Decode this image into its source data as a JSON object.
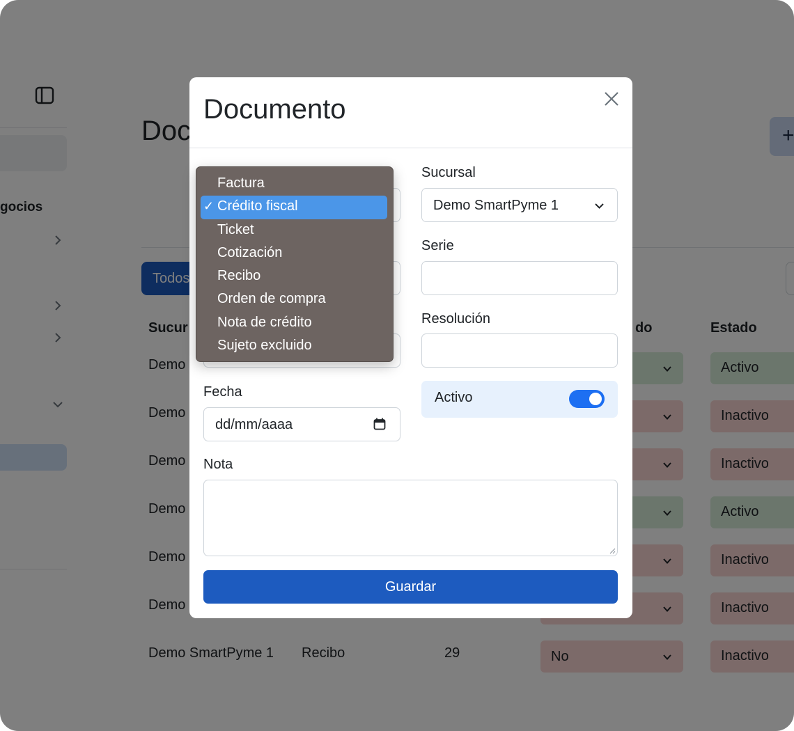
{
  "background": {
    "sidebar": {
      "section_label": "gocios"
    },
    "page_title": "Doc",
    "add_button_label": "+",
    "filter_button_label": "Todos",
    "table": {
      "headers": [
        "Sucur",
        "do",
        "Estado"
      ],
      "rows": [
        {
          "sucursal": "Demo",
          "tipo": "",
          "numero": "",
          "estado_sel": "",
          "estado": "Activo",
          "estado_color": "#d7ecd9"
        },
        {
          "sucursal": "Demo",
          "tipo": "",
          "numero": "",
          "estado_sel": "",
          "estado": "Inactivo",
          "estado_color": "#f9d5d3"
        },
        {
          "sucursal": "Demo",
          "tipo": "",
          "numero": "",
          "estado_sel": "",
          "estado": "Inactivo",
          "estado_color": "#f9d5d3"
        },
        {
          "sucursal": "Demo",
          "tipo": "",
          "numero": "",
          "estado_sel": "",
          "estado": "Activo",
          "estado_color": "#d7ecd9"
        },
        {
          "sucursal": "Demo",
          "tipo": "",
          "numero": "",
          "estado_sel": "",
          "estado": "Inactivo",
          "estado_color": "#f9d5d3"
        },
        {
          "sucursal": "Demo",
          "tipo": "",
          "numero": "",
          "estado_sel": "",
          "estado": "Inactivo",
          "estado_color": "#f9d5d3"
        },
        {
          "sucursal": "Demo SmartPyme 1",
          "tipo": "Recibo",
          "numero": "29",
          "estado_sel": "No",
          "estado": "Inactivo",
          "estado_color": "#f9d5d3"
        }
      ]
    }
  },
  "modal": {
    "title": "Documento",
    "sucursal": {
      "label": "Sucursal",
      "value": "Demo SmartPyme 1"
    },
    "serie": {
      "label": "Serie",
      "value": ""
    },
    "resolucion": {
      "label": "Resolución",
      "value": ""
    },
    "activo": {
      "label": "Activo",
      "checked": true
    },
    "fecha": {
      "label": "Fecha",
      "placeholder": "dd/mm/aaaa"
    },
    "nota": {
      "label": "Nota",
      "value": ""
    },
    "save_label": "Guardar"
  },
  "dropdown": {
    "selected_index": 1,
    "check_mark": "✓",
    "options": [
      "Factura",
      "Crédito fiscal",
      "Ticket",
      "Cotización",
      "Recibo",
      "Orden de compra",
      "Nota de crédito",
      "Sujeto excluido"
    ]
  },
  "colors": {
    "primary": "#1d5bbf",
    "switch_on": "#1d6ff2",
    "dropdown_bg": "#6d6461",
    "dropdown_highlight": "#4b96e8",
    "badge_active": "#d7ecd9",
    "badge_inactive": "#f9d5d3"
  }
}
